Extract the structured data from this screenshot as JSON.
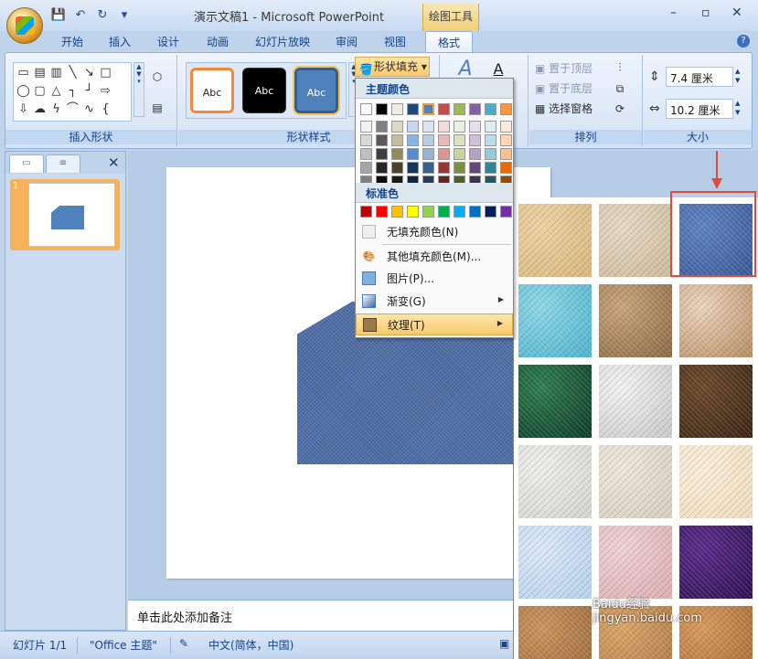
{
  "window": {
    "app_title": "演示文稿1 - Microsoft PowerPoint",
    "contextual_tab_group": "绘图工具",
    "controls": [
      "minimize-icon",
      "maximize-icon",
      "close-icon"
    ]
  },
  "quick_access": [
    "save-icon",
    "undo-icon",
    "redo-icon",
    "customize-icon"
  ],
  "tabs": [
    "开始",
    "插入",
    "设计",
    "动画",
    "幻灯片放映",
    "审阅",
    "视图",
    "格式"
  ],
  "active_tab": "格式",
  "ribbon": {
    "group_insert_shapes": "插入形状",
    "group_shape_styles": "形状样式",
    "group_arrange": "排列",
    "group_size": "大小",
    "style_swatches": [
      "Abc",
      "Abc",
      "Abc"
    ],
    "shape_fill_button": "形状填充",
    "arrange_items": [
      "置于顶层",
      "置于底层",
      "选择窗格"
    ],
    "size_height": "7.4 厘米",
    "size_width": "10.2 厘米"
  },
  "fill_menu": {
    "theme_colors_header": "主题颜色",
    "standard_colors_header": "标准色",
    "theme_top_row": [
      "#ffffff",
      "#000000",
      "#eeece1",
      "#1f497d",
      "#4f81bd",
      "#c0504d",
      "#9bbb59",
      "#8064a2",
      "#4bacc6",
      "#f79646"
    ],
    "theme_shades": [
      [
        "#f2f2f2",
        "#7f7f7f",
        "#ddd9c3",
        "#c6d9f0",
        "#dbe5f1",
        "#f2dcdb",
        "#ebf1dd",
        "#e5e0ec",
        "#dbeef3",
        "#fdeada"
      ],
      [
        "#d8d8d8",
        "#595959",
        "#c4bd97",
        "#8db3e2",
        "#b8cce4",
        "#e5b9b7",
        "#d7e3bc",
        "#ccc1d9",
        "#b7dde8",
        "#fbd5b5"
      ],
      [
        "#bfbfbf",
        "#3f3f3f",
        "#938953",
        "#548dd4",
        "#95b3d7",
        "#d99694",
        "#c3d69b",
        "#b2a2c7",
        "#92cddc",
        "#fac08f"
      ],
      [
        "#a5a5a5",
        "#262626",
        "#494429",
        "#17365d",
        "#366092",
        "#953734",
        "#76923c",
        "#5f497a",
        "#31859b",
        "#e36c09"
      ],
      [
        "#7f7f7f",
        "#0c0c0c",
        "#1d1b10",
        "#0f243e",
        "#244061",
        "#632423",
        "#4f6128",
        "#3f3151",
        "#205867",
        "#974806"
      ]
    ],
    "standard_colors": [
      "#c00000",
      "#ff0000",
      "#ffc000",
      "#ffff00",
      "#92d050",
      "#00b050",
      "#00b0f0",
      "#0070c0",
      "#002060",
      "#7030a0"
    ],
    "no_fill": "无填充颜色(N)",
    "more_colors": "其他填充颜色(M)...",
    "picture": "图片(P)...",
    "gradient": "渐变(G)",
    "texture": "纹理(T)"
  },
  "textures": [
    {
      "name": "papyrus",
      "colors": [
        "#ecd3a3",
        "#d9b77d"
      ]
    },
    {
      "name": "canvas",
      "colors": [
        "#e6d8c2",
        "#cdbb9c"
      ]
    },
    {
      "name": "denim",
      "colors": [
        "#5f82c0",
        "#3a5a96"
      ]
    },
    {
      "name": "water-droplets",
      "colors": [
        "#8fd6e6",
        "#4fb4cc"
      ]
    },
    {
      "name": "paper-bag",
      "colors": [
        "#c9a579",
        "#8a6a45"
      ]
    },
    {
      "name": "fish-fossil",
      "colors": [
        "#e9d4bd",
        "#b88d63"
      ]
    },
    {
      "name": "green-marble",
      "colors": [
        "#2e7d4f",
        "#0e3d26"
      ]
    },
    {
      "name": "white-marble",
      "colors": [
        "#f2f2f2",
        "#c9c9c9"
      ]
    },
    {
      "name": "brown-marble",
      "colors": [
        "#6b4a2b",
        "#3b2614"
      ]
    },
    {
      "name": "granite",
      "colors": [
        "#eeeeec",
        "#d4d4d0"
      ]
    },
    {
      "name": "newsprint",
      "colors": [
        "#eee7dc",
        "#d7cebf"
      ]
    },
    {
      "name": "recycled-paper",
      "colors": [
        "#fbeed8",
        "#efdcbc"
      ]
    },
    {
      "name": "blue-tissue-paper",
      "colors": [
        "#dbe9f7",
        "#b7d1ec"
      ]
    },
    {
      "name": "pink-tissue-paper",
      "colors": [
        "#efd2d2",
        "#dcaeb0"
      ]
    },
    {
      "name": "purple-mesh",
      "colors": [
        "#5a2c8a",
        "#301252"
      ]
    },
    {
      "name": "cork",
      "colors": [
        "#c9955d",
        "#9a6a3a"
      ]
    },
    {
      "name": "medium-wood",
      "colors": [
        "#d9a56a",
        "#b07a42"
      ]
    },
    {
      "name": "oak",
      "colors": [
        "#d79a5e",
        "#a66a32"
      ]
    }
  ],
  "left_pane": {
    "slide_number": "1",
    "tabs": [
      "slides-tab-icon",
      "outline-tab-icon"
    ]
  },
  "notes_placeholder": "单击此处添加备注",
  "status": {
    "slide": "幻灯片 1/1",
    "theme": "\"Office 主题\"",
    "language": "中文(简体，中国)"
  },
  "watermark": "Baidu经验 jingyan.baidu.com"
}
